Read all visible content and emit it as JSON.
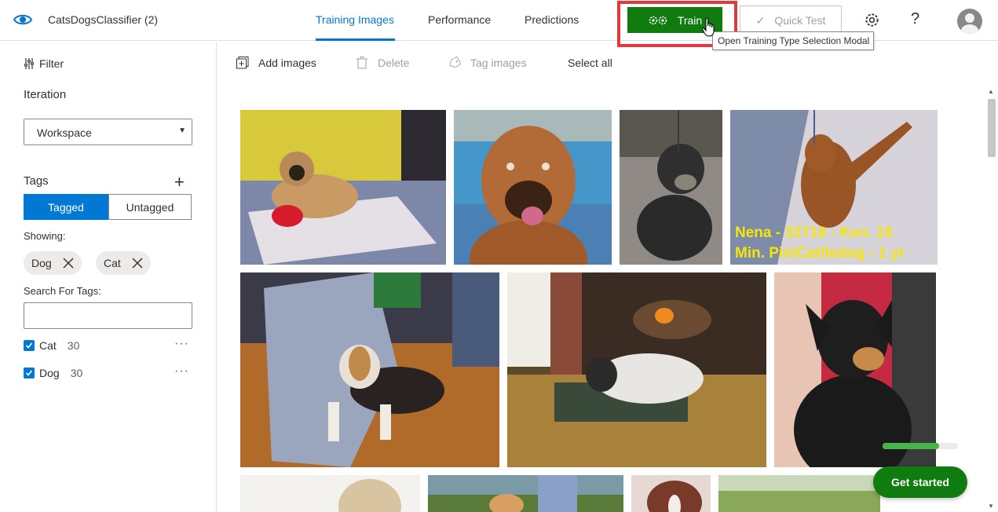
{
  "app": {
    "title": "CatsDogsClassifier (2)"
  },
  "nav": {
    "tabs": [
      {
        "label": "Training Images",
        "active": true
      },
      {
        "label": "Performance",
        "active": false
      },
      {
        "label": "Predictions",
        "active": false
      }
    ]
  },
  "header": {
    "train_label": "Train",
    "quick_test_label": "Quick Test",
    "help_label": "?",
    "tooltip": "Open Training Type Selection Modal"
  },
  "sidebar": {
    "filter_label": "Filter",
    "iteration_title": "Iteration",
    "iteration_value": "Workspace",
    "tags_title": "Tags",
    "tagged_label": "Tagged",
    "untagged_label": "Untagged",
    "showing_label": "Showing:",
    "filter_chips": [
      {
        "label": "Dog"
      },
      {
        "label": "Cat"
      }
    ],
    "search_label": "Search For Tags:",
    "search_value": "",
    "tags": [
      {
        "name": "Cat",
        "count": "30",
        "checked": true
      },
      {
        "name": "Dog",
        "count": "30",
        "checked": true
      }
    ],
    "more_label": "···"
  },
  "toolbar": {
    "add_images": "Add images",
    "delete": "Delete",
    "tag_images": "Tag images",
    "select_all": "Select all"
  },
  "images": {
    "overlay_text_line1": "Nena - 32718 - Ken. 15",
    "overlay_text_line2": "Min. Pin/Cattledog - 1 yr"
  },
  "onboarding": {
    "progress": 0.75,
    "get_started_label": "Get started"
  },
  "colors": {
    "accent": "#0078d4",
    "train_green": "#107c10",
    "highlight_red": "#e3393d",
    "progress_green": "#49b34b"
  }
}
